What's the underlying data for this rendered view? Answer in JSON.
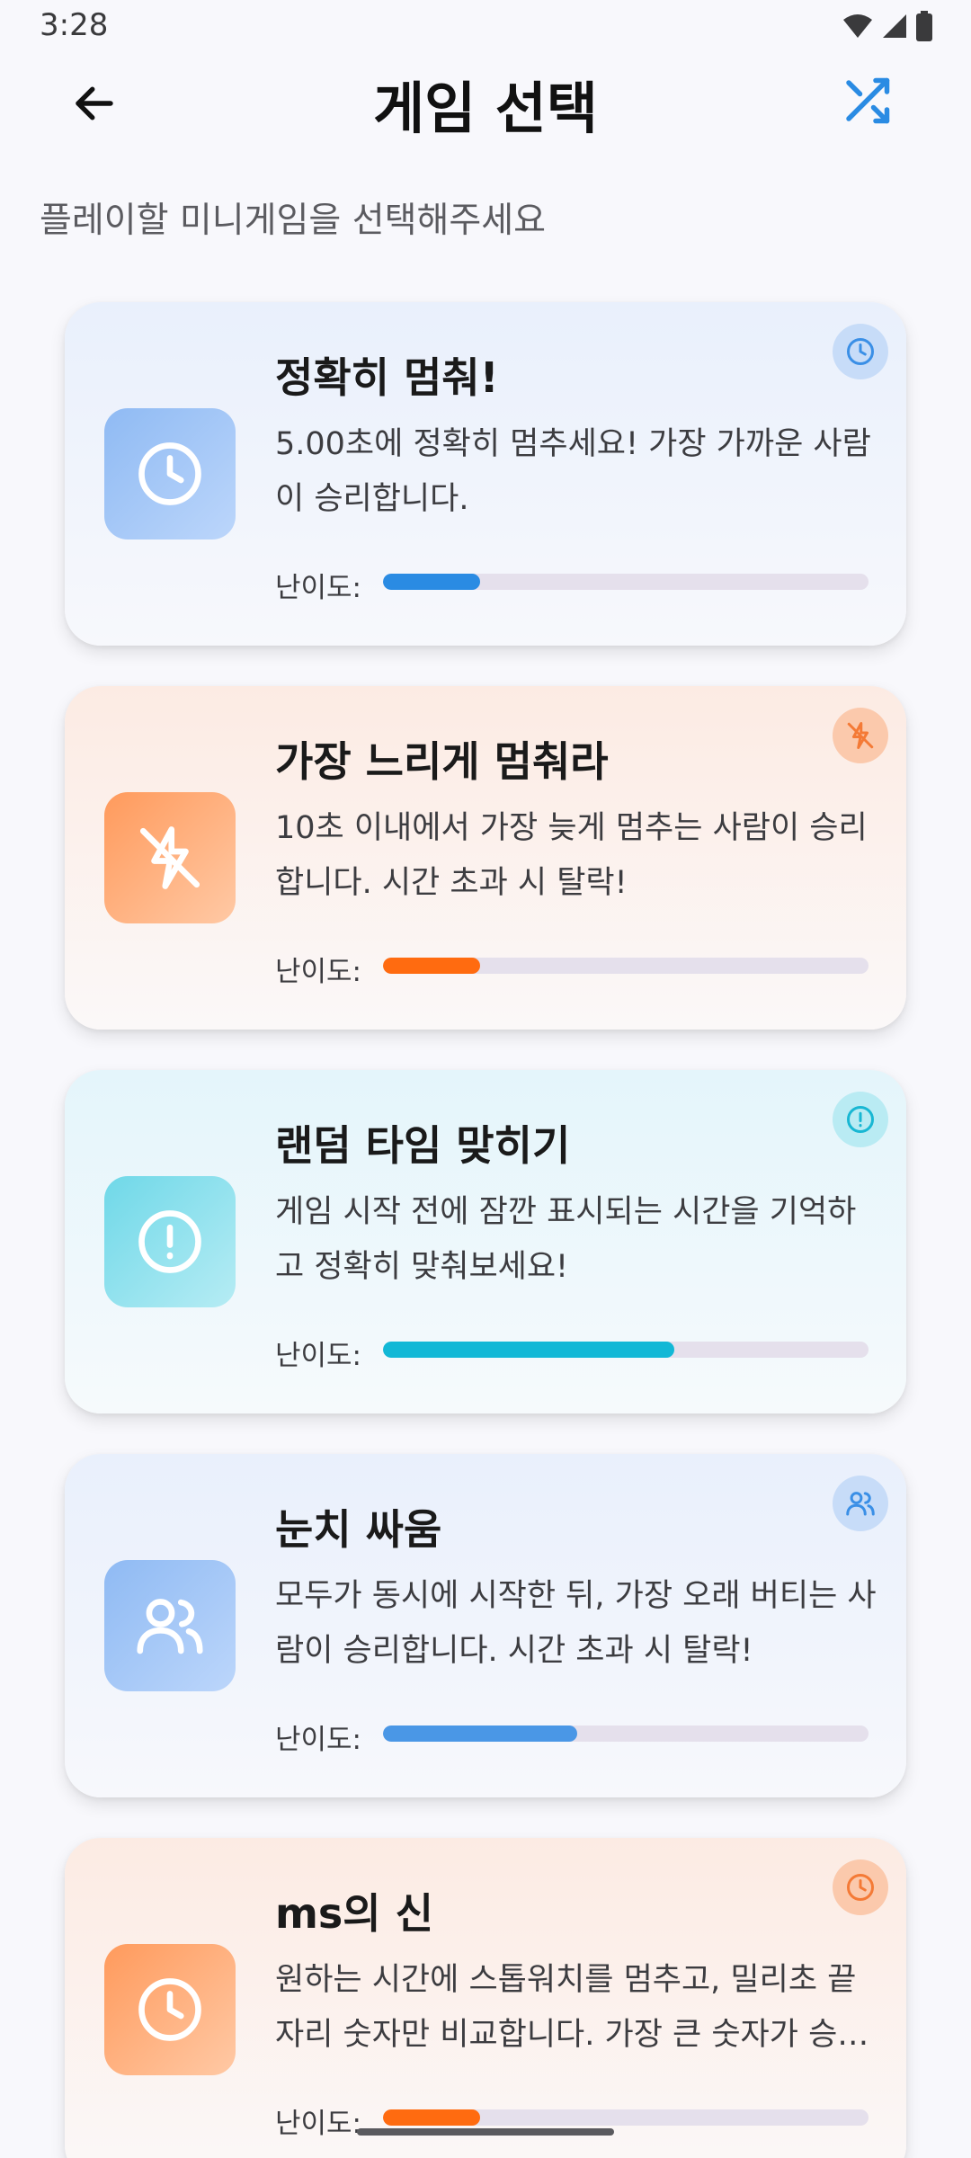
{
  "status_bar": {
    "time": "3:28"
  },
  "header": {
    "title": "게임 선택"
  },
  "subtitle": "플레이할 미니게임을 선택해주세요",
  "difficulty_label": "난이도:",
  "games": [
    {
      "title": "정확히 멈춰!",
      "description": "5.00초에 정확히 멈추세요! 가장 가까운 사람이 승리합니다.",
      "theme": "blue",
      "icon": "clock-icon",
      "difficulty": 0.2,
      "bar_color": "#2a8be3"
    },
    {
      "title": "가장 느리게 멈춰라",
      "description": "10초 이내에서 가장 늦게 멈추는 사람이 승리합니다. 시간 초과 시 탈락!",
      "theme": "orange",
      "icon": "no-flash-icon",
      "difficulty": 0.2,
      "bar_color": "#ff6b10"
    },
    {
      "title": "랜덤 타임 맞히기",
      "description": "게임 시작 전에 잠깐 표시되는 시간을 기억하고 정확히 맞춰보세요!",
      "theme": "cyan",
      "icon": "alert-circle-icon",
      "difficulty": 0.6,
      "bar_color": "#12b8d6"
    },
    {
      "title": "눈치 싸움",
      "description": "모두가 동시에 시작한 뒤, 가장 오래 버티는 사람이 승리합니다. 시간 초과 시 탈락!",
      "theme": "blue",
      "icon": "users-icon",
      "difficulty": 0.4,
      "bar_color": "#4a97e6"
    },
    {
      "title": "ms의 신",
      "description": "원하는 시간에 스톱워치를 멈추고, 밀리초 끝자리 숫자만 비교합니다. 가장 큰 숫자가 승리합니다.",
      "theme": "orange",
      "icon": "clock-icon",
      "difficulty": 0.2,
      "bar_color": "#ff6b10"
    }
  ]
}
